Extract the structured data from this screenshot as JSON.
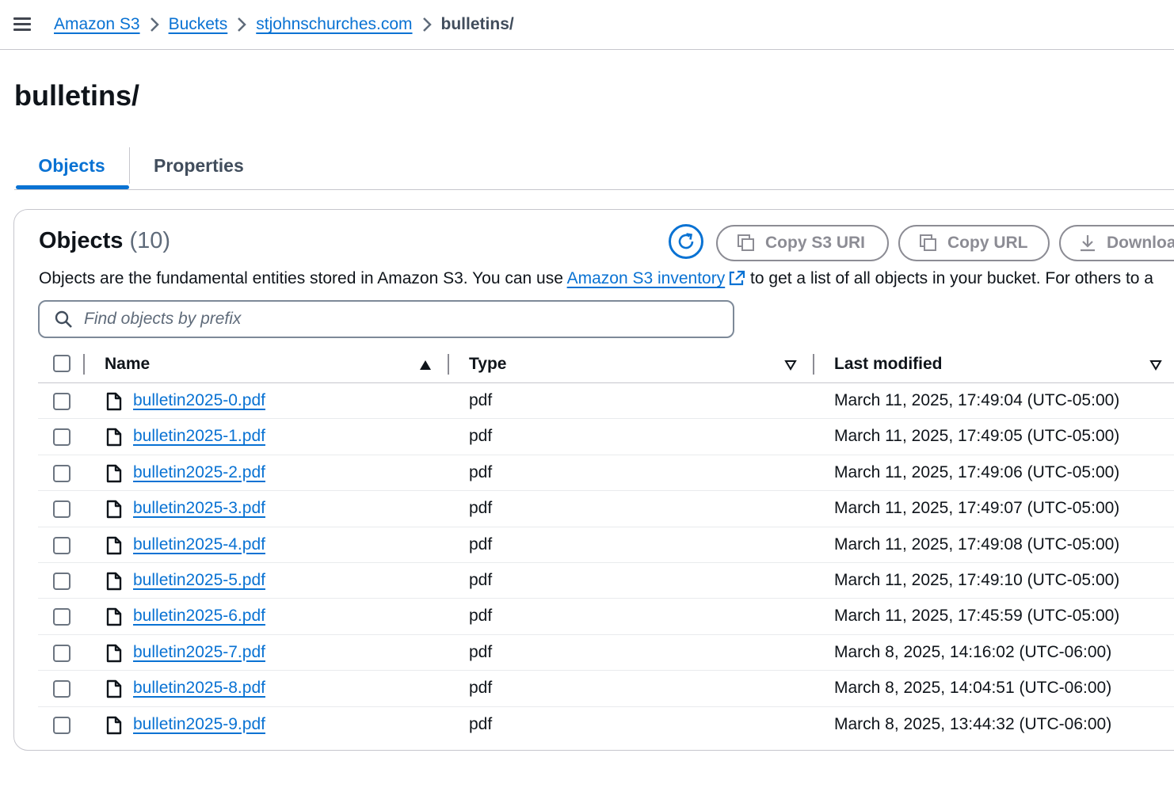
{
  "breadcrumb": {
    "items": [
      "Amazon S3",
      "Buckets",
      "stjohnschurches.com"
    ],
    "current": "bulletins/"
  },
  "page": {
    "title": "bulletins/"
  },
  "tabs": [
    {
      "label": "Objects",
      "active": true
    },
    {
      "label": "Properties",
      "active": false
    }
  ],
  "objects_panel": {
    "heading": "Objects",
    "count": "(10)",
    "buttons": {
      "copy_s3_uri": "Copy S3 URI",
      "copy_url": "Copy URL",
      "download": "Downloa"
    },
    "description_before": "Objects are the fundamental entities stored in Amazon S3. You can use ",
    "description_link": "Amazon S3 inventory",
    "description_after": " to get a list of all objects in your bucket. For others to a",
    "search_placeholder": "Find objects by prefix"
  },
  "table": {
    "columns": {
      "name": "Name",
      "type": "Type",
      "last_modified": "Last modified"
    },
    "rows": [
      {
        "name": "bulletin2025-0.pdf",
        "type": "pdf",
        "last_modified": "March 11, 2025, 17:49:04 (UTC-05:00)"
      },
      {
        "name": "bulletin2025-1.pdf",
        "type": "pdf",
        "last_modified": "March 11, 2025, 17:49:05 (UTC-05:00)"
      },
      {
        "name": "bulletin2025-2.pdf",
        "type": "pdf",
        "last_modified": "March 11, 2025, 17:49:06 (UTC-05:00)"
      },
      {
        "name": "bulletin2025-3.pdf",
        "type": "pdf",
        "last_modified": "March 11, 2025, 17:49:07 (UTC-05:00)"
      },
      {
        "name": "bulletin2025-4.pdf",
        "type": "pdf",
        "last_modified": "March 11, 2025, 17:49:08 (UTC-05:00)"
      },
      {
        "name": "bulletin2025-5.pdf",
        "type": "pdf",
        "last_modified": "March 11, 2025, 17:49:10 (UTC-05:00)"
      },
      {
        "name": "bulletin2025-6.pdf",
        "type": "pdf",
        "last_modified": "March 11, 2025, 17:45:59 (UTC-05:00)"
      },
      {
        "name": "bulletin2025-7.pdf",
        "type": "pdf",
        "last_modified": "March 8, 2025, 14:16:02 (UTC-06:00)"
      },
      {
        "name": "bulletin2025-8.pdf",
        "type": "pdf",
        "last_modified": "March 8, 2025, 14:04:51 (UTC-06:00)"
      },
      {
        "name": "bulletin2025-9.pdf",
        "type": "pdf",
        "last_modified": "March 8, 2025, 13:44:32 (UTC-06:00)"
      }
    ]
  },
  "colors": {
    "link": "#0972d3",
    "text": "#0f141a",
    "border": "#c6c6cd",
    "disabled": "#8c8c94"
  }
}
